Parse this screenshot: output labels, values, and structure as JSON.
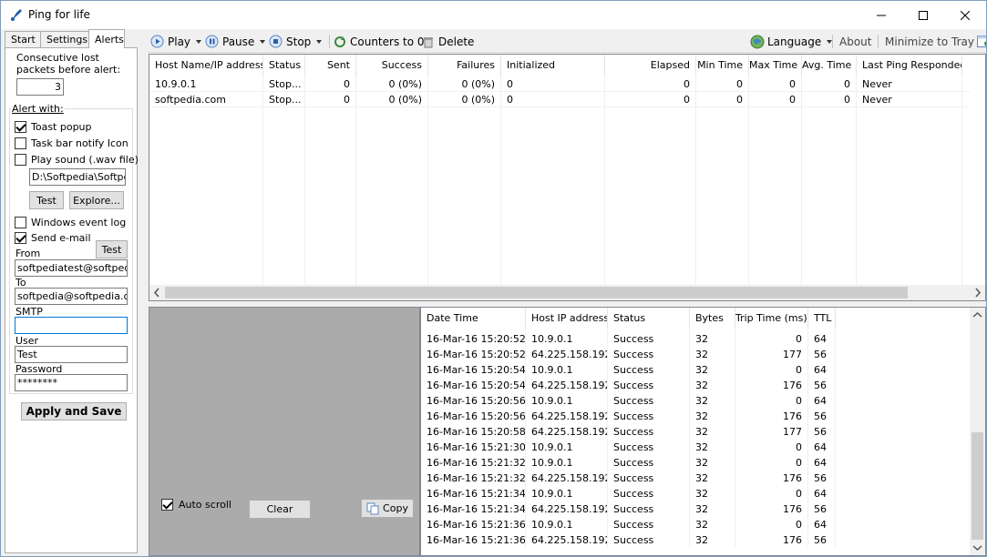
{
  "window": {
    "title": "Ping for life"
  },
  "left_panel": {
    "tabs": [
      "Start",
      "Settings",
      "Alerts"
    ],
    "active_tab": "Alerts",
    "consecutive_label_1": "Consecutive lost",
    "consecutive_label_2": "packets before alert:",
    "consecutive_value": "3",
    "alert_with_label": "Alert with:",
    "toast_popup": {
      "label": "Toast popup",
      "checked": true
    },
    "taskbar_icon": {
      "label": "Task bar notify Icon",
      "checked": false
    },
    "play_sound": {
      "label": "Play sound (.wav file)",
      "checked": false
    },
    "sound_path": "D:\\Softpedia\\Softpec",
    "test_label": "Test",
    "explore_label": "Explore...",
    "event_log": {
      "label": "Windows event log",
      "checked": false
    },
    "send_email": {
      "label": "Send e-mail",
      "checked": true
    },
    "email_test_label": "Test",
    "from_label": "From",
    "from_value": "softpediatest@softpedia.c",
    "to_label": "To",
    "to_value": "softpedia@softpedia.com",
    "smtp_label": "SMTP",
    "smtp_value": "",
    "user_label": "User",
    "user_value": "Test",
    "password_label": "Password",
    "password_value": "********",
    "apply_label": "Apply and Save"
  },
  "toolbar": {
    "play": "Play",
    "pause": "Pause",
    "stop": "Stop",
    "counters": "Counters to 0",
    "delete": "Delete",
    "language": "Language",
    "about": "About",
    "minimize": "Minimize to Tray"
  },
  "hosts_table": {
    "columns": [
      "Host Name/IP address",
      "Status",
      "Sent",
      "Success",
      "Failures",
      "Initialized",
      "Elapsed",
      "Min Time",
      "Max Time",
      "Avg. Time",
      "Last Ping Responded"
    ],
    "rows": [
      [
        "10.9.0.1",
        "Stop...",
        "0",
        "0 (0%)",
        "0 (0%)",
        "0",
        "0",
        "0",
        "0",
        "0",
        "Never"
      ],
      [
        "softpedia.com",
        "Stop...",
        "0",
        "0 (0%)",
        "0 (0%)",
        "0",
        "0",
        "0",
        "0",
        "0",
        "Never"
      ]
    ]
  },
  "bottom_controls": {
    "auto_scroll": {
      "label": "Auto scroll",
      "checked": true
    },
    "clear": "Clear",
    "copy": "Copy"
  },
  "log_table": {
    "columns": [
      "Date Time",
      "Host IP address",
      "Status",
      "Bytes",
      "Trip Time (ms)",
      "TTL"
    ],
    "rows": [
      [
        "16-Mar-16 15:20:52",
        "10.9.0.1",
        "Success",
        "32",
        "0",
        "64"
      ],
      [
        "16-Mar-16 15:20:52",
        "64.225.158.192",
        "Success",
        "32",
        "177",
        "56"
      ],
      [
        "16-Mar-16 15:20:54",
        "10.9.0.1",
        "Success",
        "32",
        "0",
        "64"
      ],
      [
        "16-Mar-16 15:20:54",
        "64.225.158.192",
        "Success",
        "32",
        "176",
        "56"
      ],
      [
        "16-Mar-16 15:20:56",
        "10.9.0.1",
        "Success",
        "32",
        "0",
        "64"
      ],
      [
        "16-Mar-16 15:20:56",
        "64.225.158.192",
        "Success",
        "32",
        "176",
        "56"
      ],
      [
        "16-Mar-16 15:20:58",
        "64.225.158.192",
        "Success",
        "32",
        "177",
        "56"
      ],
      [
        "16-Mar-16 15:21:30",
        "10.9.0.1",
        "Success",
        "32",
        "0",
        "64"
      ],
      [
        "16-Mar-16 15:21:32",
        "10.9.0.1",
        "Success",
        "32",
        "0",
        "64"
      ],
      [
        "16-Mar-16 15:21:32",
        "64.225.158.192",
        "Success",
        "32",
        "176",
        "56"
      ],
      [
        "16-Mar-16 15:21:34",
        "10.9.0.1",
        "Success",
        "32",
        "0",
        "64"
      ],
      [
        "16-Mar-16 15:21:34",
        "64.225.158.192",
        "Success",
        "32",
        "176",
        "56"
      ],
      [
        "16-Mar-16 15:21:36",
        "10.9.0.1",
        "Success",
        "32",
        "0",
        "64"
      ],
      [
        "16-Mar-16 15:21:36",
        "64.225.158.192",
        "Success",
        "32",
        "176",
        "56"
      ]
    ]
  },
  "colors": {
    "accent": "#0078d7",
    "window_bg": "#f0f0f0",
    "grid_bg": "#ababab"
  }
}
